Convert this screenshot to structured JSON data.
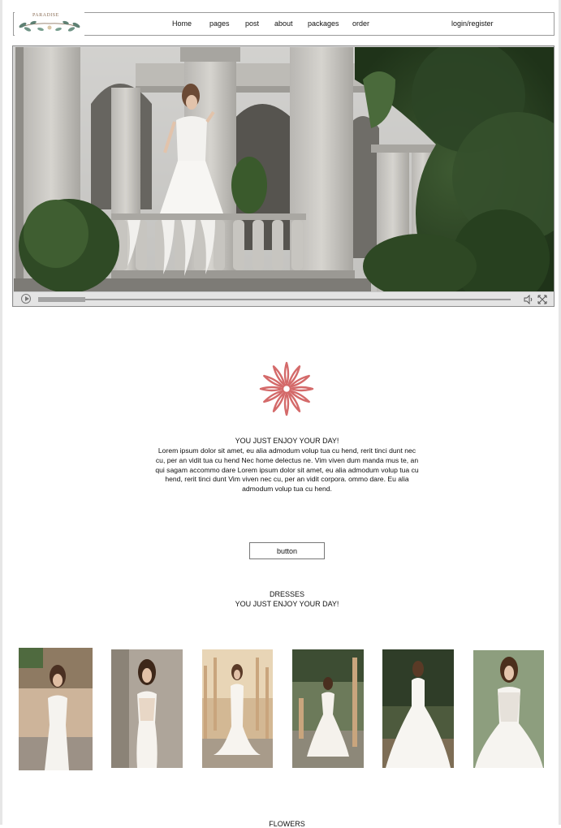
{
  "header": {
    "logo_text": "PARADISE",
    "nav": [
      "Home",
      "pages",
      "post",
      "about",
      "packages",
      "order"
    ],
    "login_label": "login/register"
  },
  "video": {
    "description_icon_play": "play-icon",
    "description_icon_volume": "volume-icon",
    "description_icon_fullscreen": "fullscreen-icon",
    "progress": 0.1
  },
  "intro": {
    "title": "YOU JUST ENJOY YOUR DAY!",
    "body": "Lorem ipsum dolor sit amet, eu alia admodum volup tua cu hend, rerit tinci dunt nec cu, per an vidit tua cu hend Nec home delectus ne. Vim viven dum manda mus te, an qui sagam accommo dare Lorem ipsum dolor sit amet, eu alia admodum volup tua cu hend, rerit tinci dunt Vim viven nec cu, per an vidit corpora. ommo dare. Eu alia admodum volup tua cu hend.",
    "button_label": "button"
  },
  "dresses": {
    "heading": "DRESSES",
    "subheading": "YOU JUST ENJOY YOUR DAY!",
    "count": 6
  },
  "flowers": {
    "heading": "FLOWERS"
  },
  "colors": {
    "accent": "#d46a6a",
    "border": "#8c8c8c"
  }
}
